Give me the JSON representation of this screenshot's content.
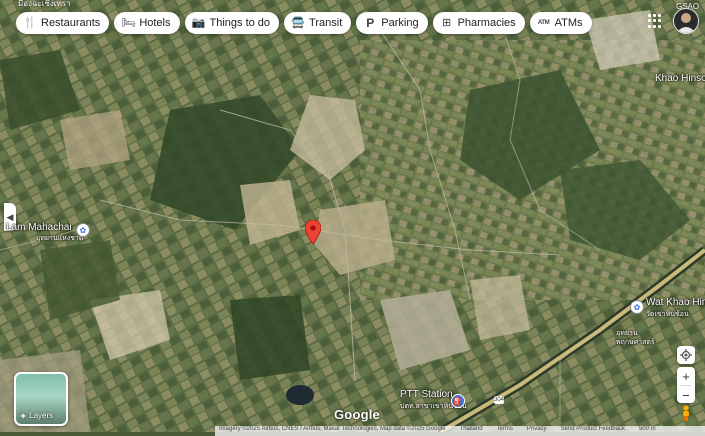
{
  "categories": [
    {
      "label": "Restaurants",
      "icon": "fork-knife-icon",
      "glyph": "🍴"
    },
    {
      "label": "Hotels",
      "icon": "bed-icon",
      "glyph": "🛏"
    },
    {
      "label": "Things to do",
      "icon": "camera-icon",
      "glyph": "📷"
    },
    {
      "label": "Transit",
      "icon": "bus-icon",
      "glyph": "🚍"
    },
    {
      "label": "Parking",
      "icon": "parking-icon",
      "glyph": "P"
    },
    {
      "label": "Pharmacies",
      "icon": "pharmacy-icon",
      "glyph": "⊞"
    },
    {
      "label": "ATMs",
      "icon": "atm-icon",
      "glyph": "ATM"
    }
  ],
  "top_partial_text": "มืองฉะเชิงเทรา",
  "top_right_partial": "GSAO",
  "places": {
    "left": {
      "name": "Lam Mahachai",
      "thai": "อุทยานแห่งชาติ"
    },
    "right_top": {
      "name": "Khao Hinsorn"
    },
    "wat": {
      "name": "Wat Khao Hin",
      "thai": "วัดเขาหินซ้อน"
    },
    "school": {
      "thai": "อุทยาน พฤกษศาสตร์"
    },
    "ptt": {
      "name": "PTT Station",
      "thai": "ปตท.สาขาเขาหินซ้อน"
    }
  },
  "layers_label": "Layers",
  "brand": "Google",
  "road_shield": "304",
  "attribution": {
    "imagery": "Imagery ©2025 Airbus, CNES / Airbus, Maxar Technologies, Map data ©2025 Google",
    "country": "Thailand",
    "terms": "Terms",
    "privacy": "Privacy",
    "feedback": "Send Product Feedback",
    "scale": "500 m"
  },
  "colors": {
    "pin": "#ea4335",
    "road": "#c9b97a"
  }
}
